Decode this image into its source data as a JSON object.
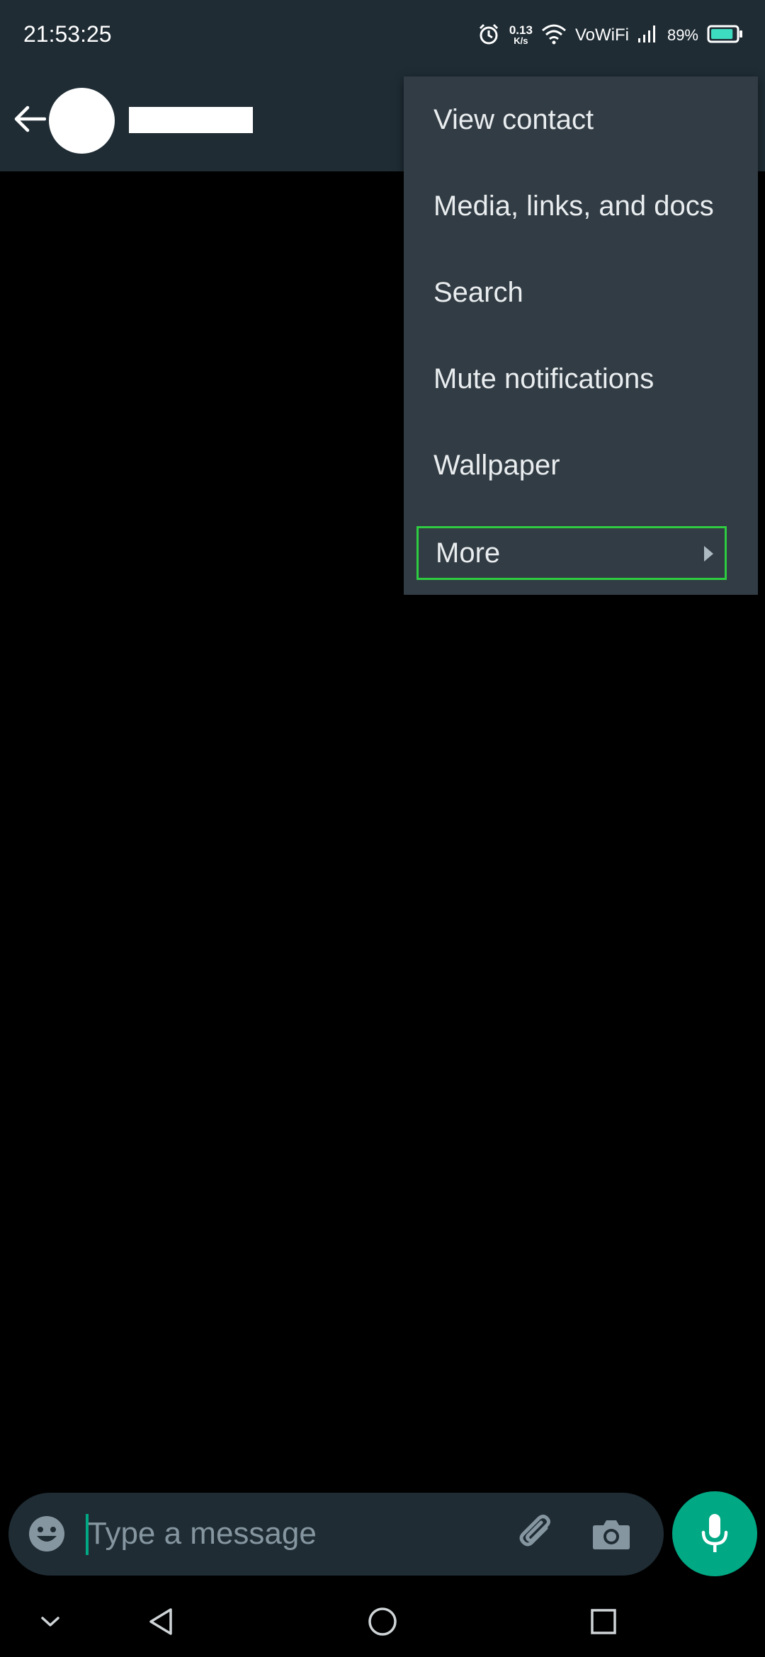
{
  "status_bar": {
    "time": "21:53:25",
    "net_speed_value": "0.13",
    "net_speed_unit": "K/s",
    "network_label": "VoWiFi",
    "battery_percent": "89%",
    "battery_level": 0.89,
    "battery_color": "#3ddbc0"
  },
  "header": {
    "back_icon": "back-arrow-icon",
    "contact_name": ""
  },
  "menu": {
    "items": [
      {
        "label": "View contact"
      },
      {
        "label": "Media, links, and docs"
      },
      {
        "label": "Search"
      },
      {
        "label": "Mute notifications"
      },
      {
        "label": "Wallpaper"
      },
      {
        "label": "More",
        "has_submenu": true
      }
    ],
    "highlight_color": "#2ecc40"
  },
  "composer": {
    "placeholder": "Type a message",
    "value": "",
    "emoji_icon": "emoji-icon",
    "attach_icon": "paperclip-icon",
    "camera_icon": "camera-icon",
    "mic_icon": "mic-icon",
    "accent_color": "#00a884"
  },
  "nav_bar": {
    "buttons": [
      "collapse-icon",
      "back-triangle-icon",
      "home-circle-icon",
      "recents-square-icon"
    ]
  }
}
